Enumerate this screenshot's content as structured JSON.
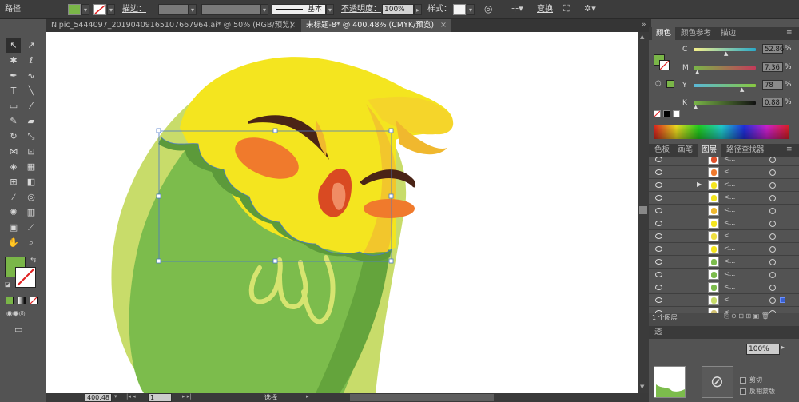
{
  "control_bar": {
    "path_label": "路径",
    "stroke_label": "描边",
    "stroke_colon": "：",
    "profile_label": "基本",
    "opacity_label": "不透明度",
    "opacity_colon": "：",
    "opacity_value": "100%",
    "style_label": "样式",
    "style_colon": "：",
    "transform_label": "变换",
    "fill_color": "#7ab648"
  },
  "tabs": [
    {
      "label": "Nipic_5444097_20190409165107667964.ai* @ 50% (RGB/预览)",
      "close": "×"
    },
    {
      "label": "未标题-8* @ 400.48% (CMYK/预览)",
      "close": "×"
    }
  ],
  "color_panel": {
    "tabs": [
      "颜色",
      "颜色参考",
      "描边"
    ],
    "sliders": [
      {
        "label": "C",
        "value": "52.86",
        "pct": 0.5286
      },
      {
        "label": "M",
        "value": "7.36",
        "pct": 0.0736
      },
      {
        "label": "Y",
        "value": "78",
        "pct": 0.78
      },
      {
        "label": "K",
        "value": "0.88",
        "pct": 0.0088
      }
    ],
    "fill_color": "#7ab648"
  },
  "layers_panel": {
    "tabs": [
      "色板",
      "画笔",
      "图层",
      "路径查找器"
    ],
    "row_names": [
      "<...",
      "<...",
      "<...",
      "<...",
      "<...",
      "<...",
      "<...",
      "<...",
      "<...",
      "<...",
      "<...",
      "<...",
      "<..."
    ],
    "footer_label": "1 个图层"
  },
  "bottom_panel": {
    "tab_label": "透",
    "zoom_value": "100%",
    "clip_label": "剪切",
    "invert_label": "反相蒙版"
  },
  "status_bar": {
    "zoom_value": "400.48",
    "page_value": "1",
    "tool_label": "选择"
  }
}
